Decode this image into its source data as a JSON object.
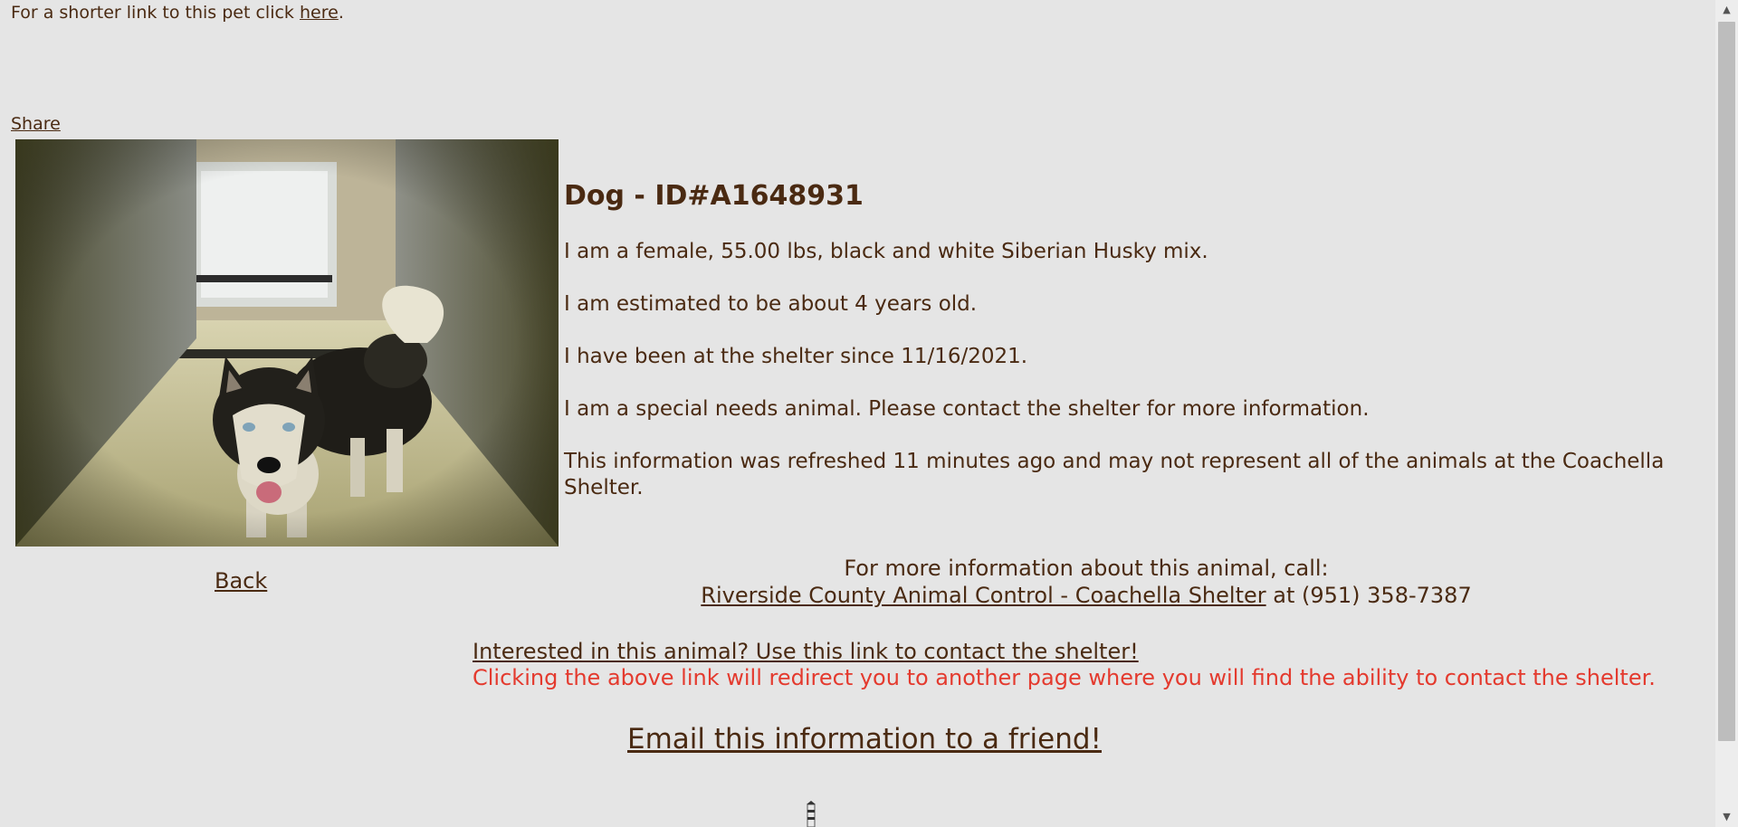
{
  "top": {
    "prefix": "For a shorter link to this pet click ",
    "link": "here",
    "suffix": "."
  },
  "share_label": "Share",
  "photo": {
    "alt": "black and white Siberian Husky in shelter kennel"
  },
  "back_label": "Back",
  "animal": {
    "heading": "Dog - ID#A1648931",
    "description": "I am a female, 55.00 lbs, black and white Siberian Husky mix.",
    "age": "I am estimated to be about 4 years old.",
    "since": "I have been at the shelter since 11/16/2021.",
    "special_needs": "I am a special needs animal. Please contact the shelter for more information.",
    "refreshed": "This information was refreshed 11 minutes ago and may not represent all of the animals at the Coachella Shelter."
  },
  "call": {
    "label": "For more information about this animal, call:",
    "shelter_link": "Riverside County Animal Control - Coachella Shelter",
    "phone": " at (951) 358-7387"
  },
  "contact": {
    "link": "Interested in this animal? Use this link to contact the shelter!",
    "note": "Clicking the above link will redirect you to another page where you will find the ability to contact the shelter."
  },
  "email_label": "Email this information to a friend!",
  "colors": {
    "background": "#e5e5e5",
    "text": "#4a2a12",
    "warning": "#e43a2e"
  },
  "icons": {
    "scroll_up": "chevron-up-icon",
    "scroll_down": "chevron-down-icon",
    "loading": "lighthouse-icon"
  }
}
